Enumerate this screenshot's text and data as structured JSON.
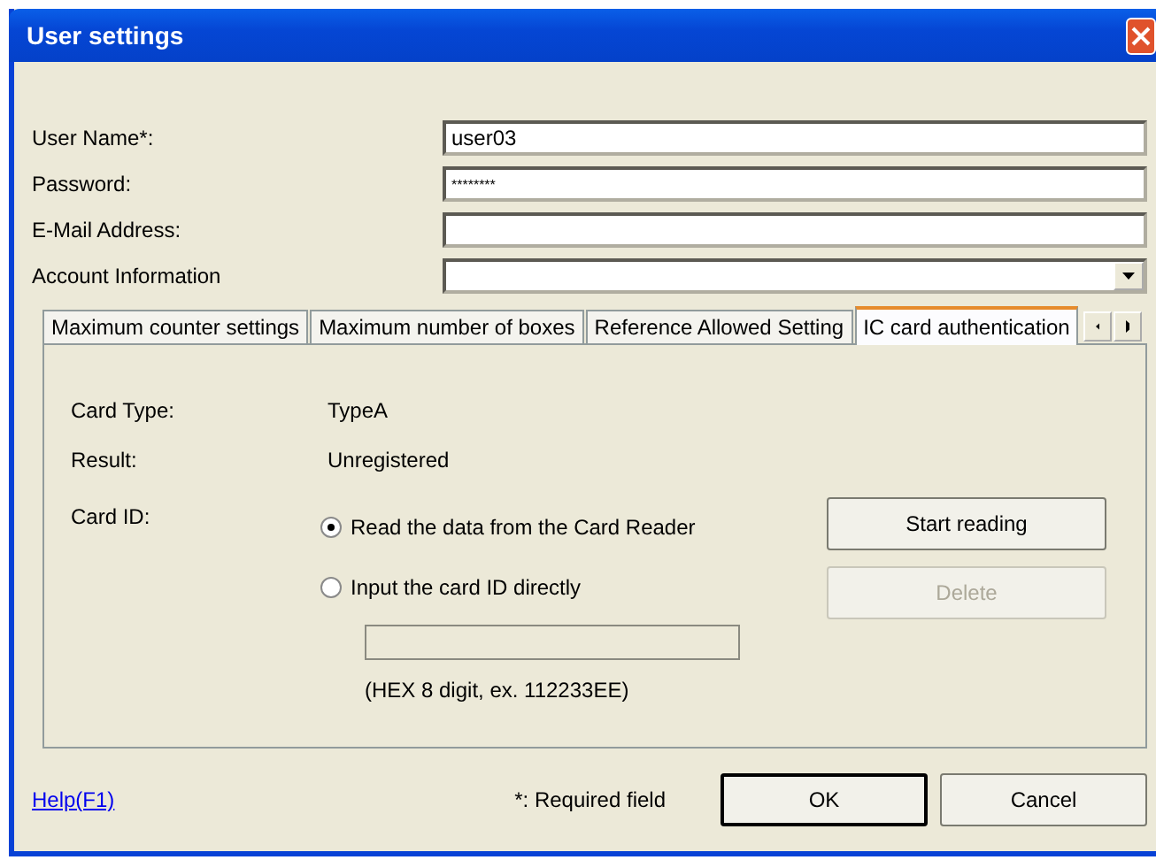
{
  "window": {
    "title": "User settings"
  },
  "fields": [
    {
      "label": "User Name*:",
      "kind": "text",
      "value": "user03"
    },
    {
      "label": "Password:",
      "kind": "password",
      "value": "********"
    },
    {
      "label": "E-Mail Address:",
      "kind": "text"
    },
    {
      "label": "Account Information",
      "kind": "dropdown"
    }
  ],
  "tabs": [
    {
      "label": "Maximum counter settings",
      "selected": false
    },
    {
      "label": "Maximum number of boxes",
      "selected": false
    },
    {
      "label": "Reference Allowed Setting",
      "selected": false
    },
    {
      "label": "IC card authentication",
      "selected": true
    }
  ],
  "card": {
    "rows": [
      {
        "label": "Card Type:",
        "value": "TypeA"
      },
      {
        "label": "Result:",
        "value": "Unregistered"
      }
    ],
    "card_id_label": "Card ID:",
    "options": [
      {
        "label": "Read the data from the Card Reader",
        "selected": true
      },
      {
        "label": "Input the card ID directly",
        "selected": false
      }
    ],
    "card_id_field": {
      "disabled": true
    },
    "hint": "(HEX 8 digit, ex. 112233EE)",
    "buttons": [
      {
        "label": "Start reading",
        "disabled": false
      },
      {
        "label": "Delete",
        "disabled": true
      }
    ]
  },
  "footer": {
    "help_link": "Help(F1)",
    "note": "*: Required field",
    "buttons": [
      {
        "label": "OK",
        "default": true
      },
      {
        "label": "Cancel",
        "default": false
      }
    ]
  }
}
